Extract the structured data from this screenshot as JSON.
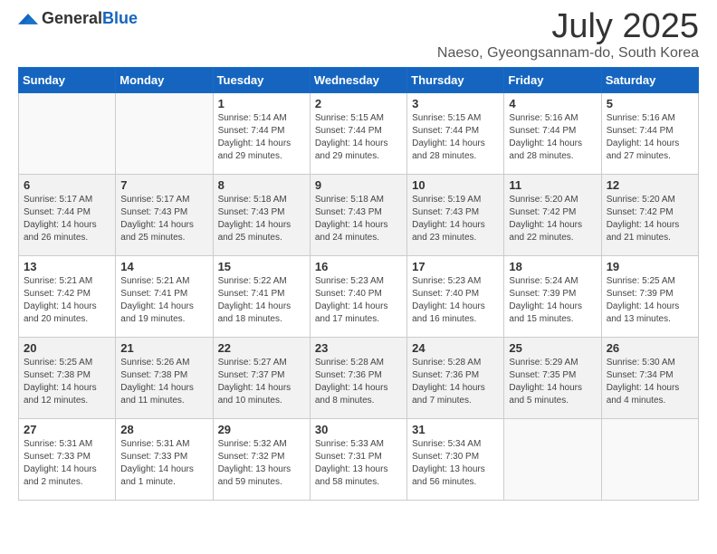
{
  "header": {
    "logo_general": "General",
    "logo_blue": "Blue",
    "month": "July 2025",
    "location": "Naeso, Gyeongsannam-do, South Korea"
  },
  "weekdays": [
    "Sunday",
    "Monday",
    "Tuesday",
    "Wednesday",
    "Thursday",
    "Friday",
    "Saturday"
  ],
  "weeks": [
    [
      {
        "day": "",
        "sunrise": "",
        "sunset": "",
        "daylight": ""
      },
      {
        "day": "",
        "sunrise": "",
        "sunset": "",
        "daylight": ""
      },
      {
        "day": "1",
        "sunrise": "Sunrise: 5:14 AM",
        "sunset": "Sunset: 7:44 PM",
        "daylight": "Daylight: 14 hours and 29 minutes."
      },
      {
        "day": "2",
        "sunrise": "Sunrise: 5:15 AM",
        "sunset": "Sunset: 7:44 PM",
        "daylight": "Daylight: 14 hours and 29 minutes."
      },
      {
        "day": "3",
        "sunrise": "Sunrise: 5:15 AM",
        "sunset": "Sunset: 7:44 PM",
        "daylight": "Daylight: 14 hours and 28 minutes."
      },
      {
        "day": "4",
        "sunrise": "Sunrise: 5:16 AM",
        "sunset": "Sunset: 7:44 PM",
        "daylight": "Daylight: 14 hours and 28 minutes."
      },
      {
        "day": "5",
        "sunrise": "Sunrise: 5:16 AM",
        "sunset": "Sunset: 7:44 PM",
        "daylight": "Daylight: 14 hours and 27 minutes."
      }
    ],
    [
      {
        "day": "6",
        "sunrise": "Sunrise: 5:17 AM",
        "sunset": "Sunset: 7:44 PM",
        "daylight": "Daylight: 14 hours and 26 minutes."
      },
      {
        "day": "7",
        "sunrise": "Sunrise: 5:17 AM",
        "sunset": "Sunset: 7:43 PM",
        "daylight": "Daylight: 14 hours and 25 minutes."
      },
      {
        "day": "8",
        "sunrise": "Sunrise: 5:18 AM",
        "sunset": "Sunset: 7:43 PM",
        "daylight": "Daylight: 14 hours and 25 minutes."
      },
      {
        "day": "9",
        "sunrise": "Sunrise: 5:18 AM",
        "sunset": "Sunset: 7:43 PM",
        "daylight": "Daylight: 14 hours and 24 minutes."
      },
      {
        "day": "10",
        "sunrise": "Sunrise: 5:19 AM",
        "sunset": "Sunset: 7:43 PM",
        "daylight": "Daylight: 14 hours and 23 minutes."
      },
      {
        "day": "11",
        "sunrise": "Sunrise: 5:20 AM",
        "sunset": "Sunset: 7:42 PM",
        "daylight": "Daylight: 14 hours and 22 minutes."
      },
      {
        "day": "12",
        "sunrise": "Sunrise: 5:20 AM",
        "sunset": "Sunset: 7:42 PM",
        "daylight": "Daylight: 14 hours and 21 minutes."
      }
    ],
    [
      {
        "day": "13",
        "sunrise": "Sunrise: 5:21 AM",
        "sunset": "Sunset: 7:42 PM",
        "daylight": "Daylight: 14 hours and 20 minutes."
      },
      {
        "day": "14",
        "sunrise": "Sunrise: 5:21 AM",
        "sunset": "Sunset: 7:41 PM",
        "daylight": "Daylight: 14 hours and 19 minutes."
      },
      {
        "day": "15",
        "sunrise": "Sunrise: 5:22 AM",
        "sunset": "Sunset: 7:41 PM",
        "daylight": "Daylight: 14 hours and 18 minutes."
      },
      {
        "day": "16",
        "sunrise": "Sunrise: 5:23 AM",
        "sunset": "Sunset: 7:40 PM",
        "daylight": "Daylight: 14 hours and 17 minutes."
      },
      {
        "day": "17",
        "sunrise": "Sunrise: 5:23 AM",
        "sunset": "Sunset: 7:40 PM",
        "daylight": "Daylight: 14 hours and 16 minutes."
      },
      {
        "day": "18",
        "sunrise": "Sunrise: 5:24 AM",
        "sunset": "Sunset: 7:39 PM",
        "daylight": "Daylight: 14 hours and 15 minutes."
      },
      {
        "day": "19",
        "sunrise": "Sunrise: 5:25 AM",
        "sunset": "Sunset: 7:39 PM",
        "daylight": "Daylight: 14 hours and 13 minutes."
      }
    ],
    [
      {
        "day": "20",
        "sunrise": "Sunrise: 5:25 AM",
        "sunset": "Sunset: 7:38 PM",
        "daylight": "Daylight: 14 hours and 12 minutes."
      },
      {
        "day": "21",
        "sunrise": "Sunrise: 5:26 AM",
        "sunset": "Sunset: 7:38 PM",
        "daylight": "Daylight: 14 hours and 11 minutes."
      },
      {
        "day": "22",
        "sunrise": "Sunrise: 5:27 AM",
        "sunset": "Sunset: 7:37 PM",
        "daylight": "Daylight: 14 hours and 10 minutes."
      },
      {
        "day": "23",
        "sunrise": "Sunrise: 5:28 AM",
        "sunset": "Sunset: 7:36 PM",
        "daylight": "Daylight: 14 hours and 8 minutes."
      },
      {
        "day": "24",
        "sunrise": "Sunrise: 5:28 AM",
        "sunset": "Sunset: 7:36 PM",
        "daylight": "Daylight: 14 hours and 7 minutes."
      },
      {
        "day": "25",
        "sunrise": "Sunrise: 5:29 AM",
        "sunset": "Sunset: 7:35 PM",
        "daylight": "Daylight: 14 hours and 5 minutes."
      },
      {
        "day": "26",
        "sunrise": "Sunrise: 5:30 AM",
        "sunset": "Sunset: 7:34 PM",
        "daylight": "Daylight: 14 hours and 4 minutes."
      }
    ],
    [
      {
        "day": "27",
        "sunrise": "Sunrise: 5:31 AM",
        "sunset": "Sunset: 7:33 PM",
        "daylight": "Daylight: 14 hours and 2 minutes."
      },
      {
        "day": "28",
        "sunrise": "Sunrise: 5:31 AM",
        "sunset": "Sunset: 7:33 PM",
        "daylight": "Daylight: 14 hours and 1 minute."
      },
      {
        "day": "29",
        "sunrise": "Sunrise: 5:32 AM",
        "sunset": "Sunset: 7:32 PM",
        "daylight": "Daylight: 13 hours and 59 minutes."
      },
      {
        "day": "30",
        "sunrise": "Sunrise: 5:33 AM",
        "sunset": "Sunset: 7:31 PM",
        "daylight": "Daylight: 13 hours and 58 minutes."
      },
      {
        "day": "31",
        "sunrise": "Sunrise: 5:34 AM",
        "sunset": "Sunset: 7:30 PM",
        "daylight": "Daylight: 13 hours and 56 minutes."
      },
      {
        "day": "",
        "sunrise": "",
        "sunset": "",
        "daylight": ""
      },
      {
        "day": "",
        "sunrise": "",
        "sunset": "",
        "daylight": ""
      }
    ]
  ]
}
